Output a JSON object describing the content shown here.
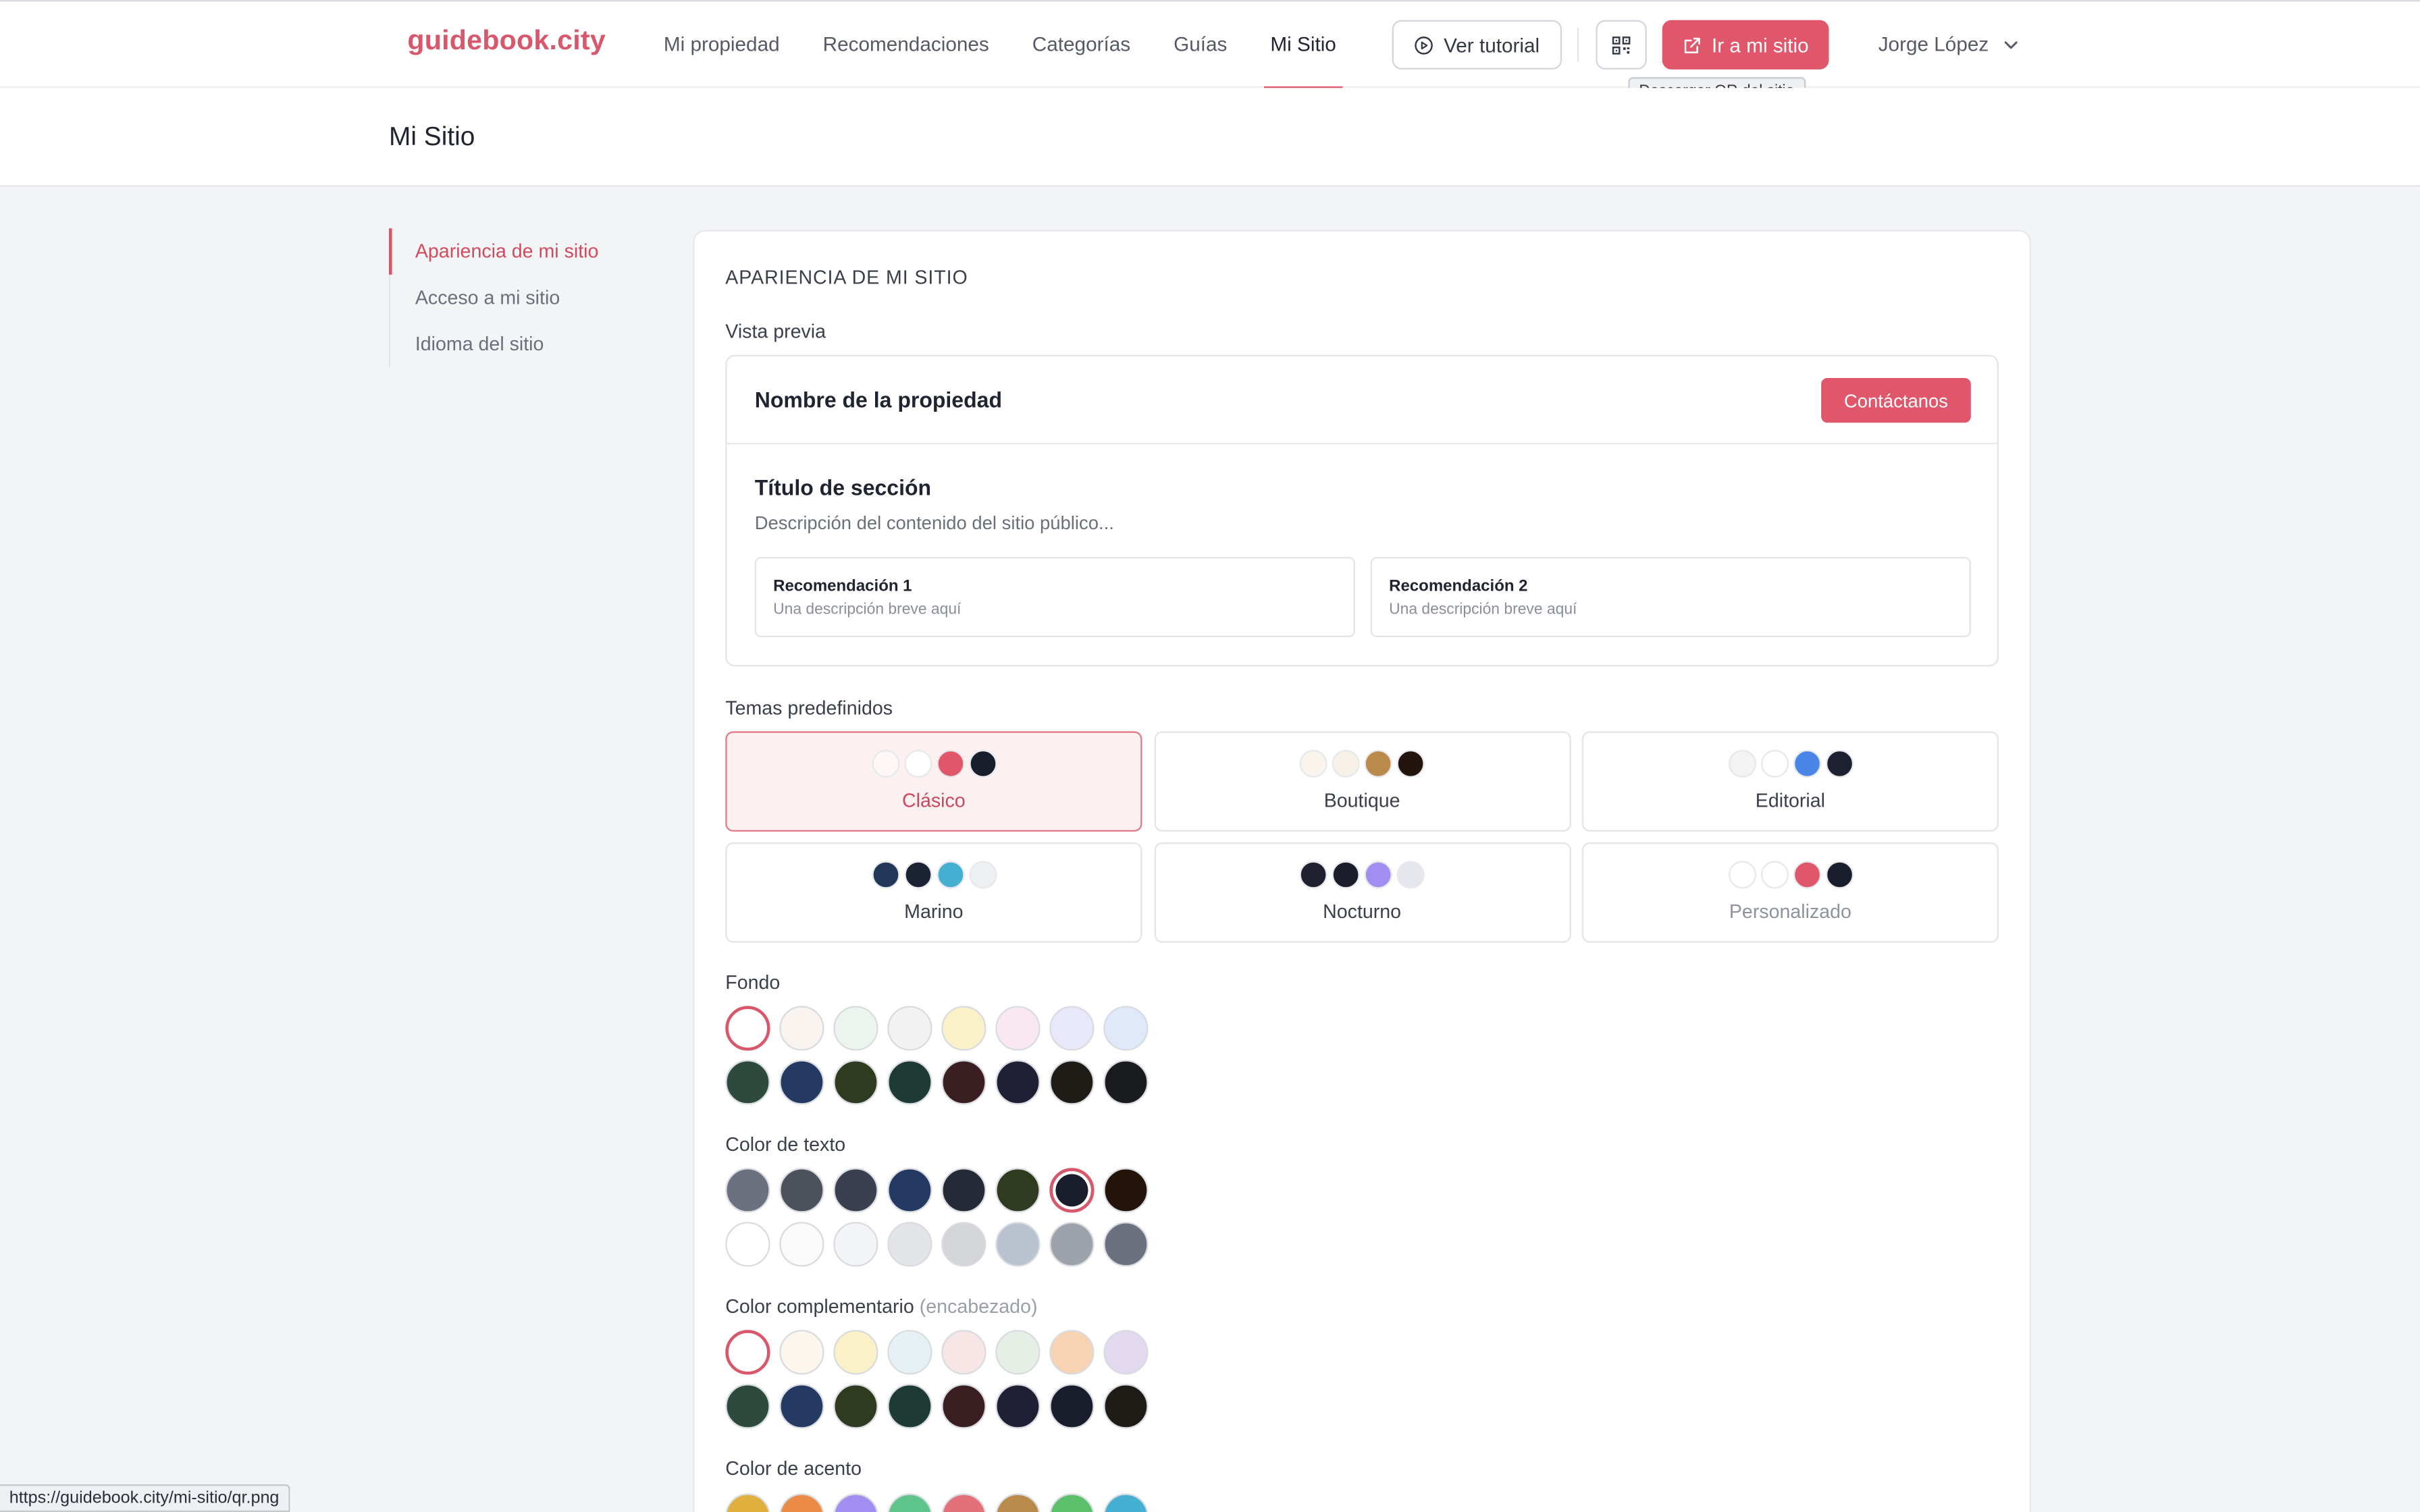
{
  "header": {
    "logo": "guidebook.city",
    "nav": [
      "Mi propiedad",
      "Recomendaciones",
      "Categorías",
      "Guías",
      "Mi Sitio"
    ],
    "active_nav": "Mi Sitio",
    "tutorial_label": "Ver tutorial",
    "qr_tooltip": "Descargar QR del sitio",
    "go_site_label": "Ir a mi sitio",
    "user_name": "Jorge López"
  },
  "page": {
    "title": "Mi Sitio"
  },
  "sidebar": {
    "items": [
      "Apariencia de mi sitio",
      "Acceso a mi sitio",
      "Idioma del sitio"
    ]
  },
  "appearance": {
    "section_title": "APARIENCIA DE MI SITIO",
    "preview_label": "Vista previa",
    "preview": {
      "property_name": "Nombre de la propiedad",
      "contact_button": "Contáctanos",
      "section_title": "Título de sección",
      "section_desc": "Descripción del contenido del sitio público...",
      "recs": [
        {
          "title": "Recomendación 1",
          "desc": "Una descripción breve aquí"
        },
        {
          "title": "Recomendación 2",
          "desc": "Una descripción breve aquí"
        }
      ]
    },
    "themes_label": "Temas predefinidos",
    "themes": [
      {
        "name": "Clásico",
        "state": "active",
        "colors": [
          "#fdf7f6",
          "#ffffff",
          "#e0566a",
          "#1a1d2b"
        ]
      },
      {
        "name": "Boutique",
        "state": "",
        "colors": [
          "#faf4ec",
          "#f8f1e8",
          "#b98a4a",
          "#22150d"
        ]
      },
      {
        "name": "Editorial",
        "state": "",
        "colors": [
          "#f3f3f4",
          "#ffffff",
          "#4a86e8",
          "#1d2030"
        ]
      },
      {
        "name": "Marino",
        "state": "",
        "colors": [
          "#213659",
          "#1b2233",
          "#45b0d2",
          "#eef0f4"
        ]
      },
      {
        "name": "Nocturno",
        "state": "",
        "colors": [
          "#1f2130",
          "#1b1d2a",
          "#a28ef0",
          "#e6e7ec"
        ]
      },
      {
        "name": "Personalizado",
        "state": "muted",
        "colors": [
          "#ffffff",
          "#ffffff",
          "#e0566a",
          "#1a1d2b"
        ]
      }
    ],
    "fondo_label": "Fondo",
    "fondo": [
      "#ffffff",
      "#f9f4ef",
      "#edf4ee",
      "#f2f2f2",
      "#fbf1c8",
      "#f9e7f1",
      "#e9e8fa",
      "#dfe9fa",
      "#2d4a3d",
      "#243a63",
      "#2f3a1f",
      "#1e3a35",
      "#3a1e22",
      "#1f2035",
      "#1f1c17",
      "#1a1b1f"
    ],
    "fondo_selected": 0,
    "texto_label": "Color de texto",
    "texto": [
      "#6b717e",
      "#4c515c",
      "#3a4050",
      "#243a63",
      "#252a36",
      "#2f3a1f",
      "#1a1d2b",
      "#241309",
      "#ffffff",
      "#fafafa",
      "#f3f4f6",
      "#e3e4e7",
      "#d4d5d9",
      "#b9c3d0",
      "#9ea2aa",
      "#6b717e"
    ],
    "texto_selected": 6,
    "complementario_label": "Color complementario",
    "complementario_hint": "(encabezado)",
    "complementario": [
      "#ffffff",
      "#fcf6ec",
      "#fbf1c8",
      "#e5f1f4",
      "#f8e5e5",
      "#e5efe6",
      "#f8d3b2",
      "#e2d8f0",
      "#2d4a3d",
      "#243a63",
      "#2f3a1f",
      "#1e3a35",
      "#3a1e22",
      "#1f2035",
      "#1a1d2b",
      "#1f1c17"
    ],
    "complementario_selected": 0,
    "acento_label": "Color de acento",
    "acento": [
      "#e0b03e",
      "#ec8a47",
      "#a28ef0",
      "#5ec48a",
      "#e4707a",
      "#b98a4a",
      "#5cc06a",
      "#45b0d2"
    ]
  },
  "status_url": "https://guidebook.city/mi-sitio/qr.png"
}
